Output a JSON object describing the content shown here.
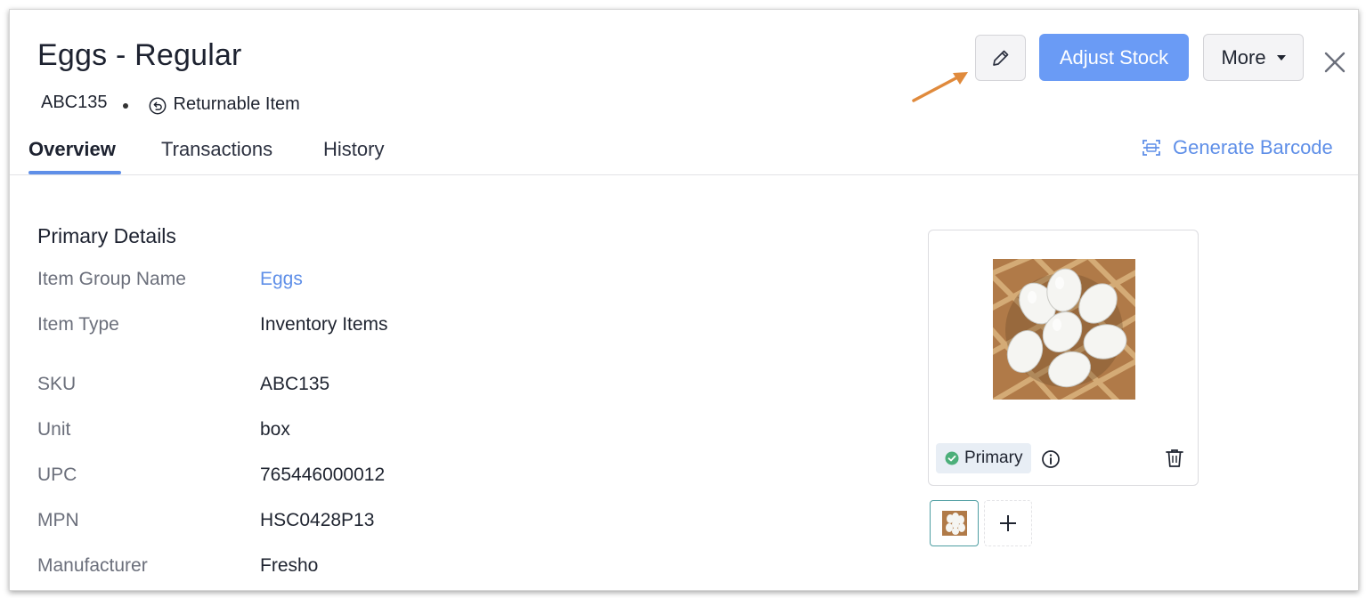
{
  "header": {
    "title": "Eggs - Regular",
    "sku": "ABC135",
    "returnable_label": "Returnable Item"
  },
  "actions": {
    "edit_icon": "pencil-icon",
    "adjust_stock_label": "Adjust Stock",
    "more_label": "More",
    "close_icon": "close-icon"
  },
  "tabs": [
    {
      "label": "Overview",
      "active": true
    },
    {
      "label": "Transactions",
      "active": false
    },
    {
      "label": "History",
      "active": false
    }
  ],
  "generate_barcode_label": "Generate Barcode",
  "primary_details": {
    "section_title": "Primary Details",
    "rows": [
      {
        "label": "Item Group Name",
        "value": "Eggs",
        "is_link": true
      },
      {
        "label": "Item Type",
        "value": "Inventory Items"
      },
      {
        "label": "SKU",
        "value": "ABC135"
      },
      {
        "label": "Unit",
        "value": "box"
      },
      {
        "label": "UPC",
        "value": "765446000012"
      },
      {
        "label": "MPN",
        "value": "HSC0428P13"
      },
      {
        "label": "Manufacturer",
        "value": "Fresho"
      }
    ]
  },
  "image_panel": {
    "primary_badge": "Primary",
    "icons": [
      "check-circle-icon",
      "info-icon",
      "trash-icon",
      "plus-icon"
    ]
  },
  "colors": {
    "accent": "#5f8fe8",
    "button_primary": "#6a9bf5",
    "annotation_arrow": "#e08a3c",
    "badge_check": "#4caf7a"
  }
}
